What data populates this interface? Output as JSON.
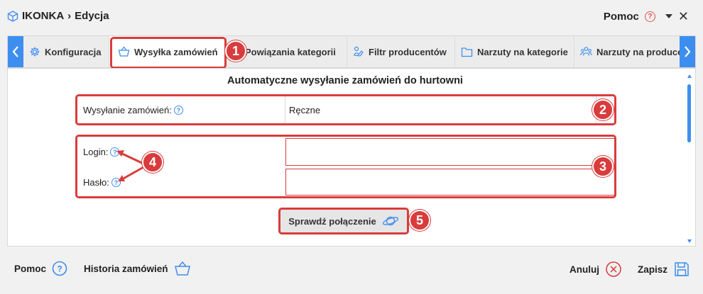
{
  "header": {
    "app_name": "IKONKA",
    "separator": "›",
    "page": "Edycja",
    "help_label": "Pomoc"
  },
  "tabs": [
    {
      "label": "Konfiguracja",
      "icon": "gear-icon"
    },
    {
      "label": "Wysyłka zamówień",
      "icon": "basket-icon",
      "active": true
    },
    {
      "label": "Powiązania kategorii",
      "icon": "link-icon"
    },
    {
      "label": "Filtr producentów",
      "icon": "filter-icon"
    },
    {
      "label": "Narzuty na kategorie",
      "icon": "folder-icon"
    },
    {
      "label": "Narzuty na producentów",
      "icon": "people-icon"
    }
  ],
  "section": {
    "title": "Automatyczne wysyłanie zamówień do hurtowni"
  },
  "form": {
    "mode_label": "Wysyłanie zamówień:",
    "mode_value": "Ręczne",
    "login_label": "Login:",
    "login_value": "",
    "password_label": "Hasło:",
    "password_value": "",
    "check_button": "Sprawdź połączenie"
  },
  "badges": [
    "1",
    "2",
    "3",
    "4",
    "5"
  ],
  "footer": {
    "help": "Pomoc",
    "history": "Historia zamówień",
    "cancel": "Anuluj",
    "save": "Zapisz"
  },
  "colors": {
    "accent": "#3e8ef0",
    "highlight": "#d93c3c"
  }
}
